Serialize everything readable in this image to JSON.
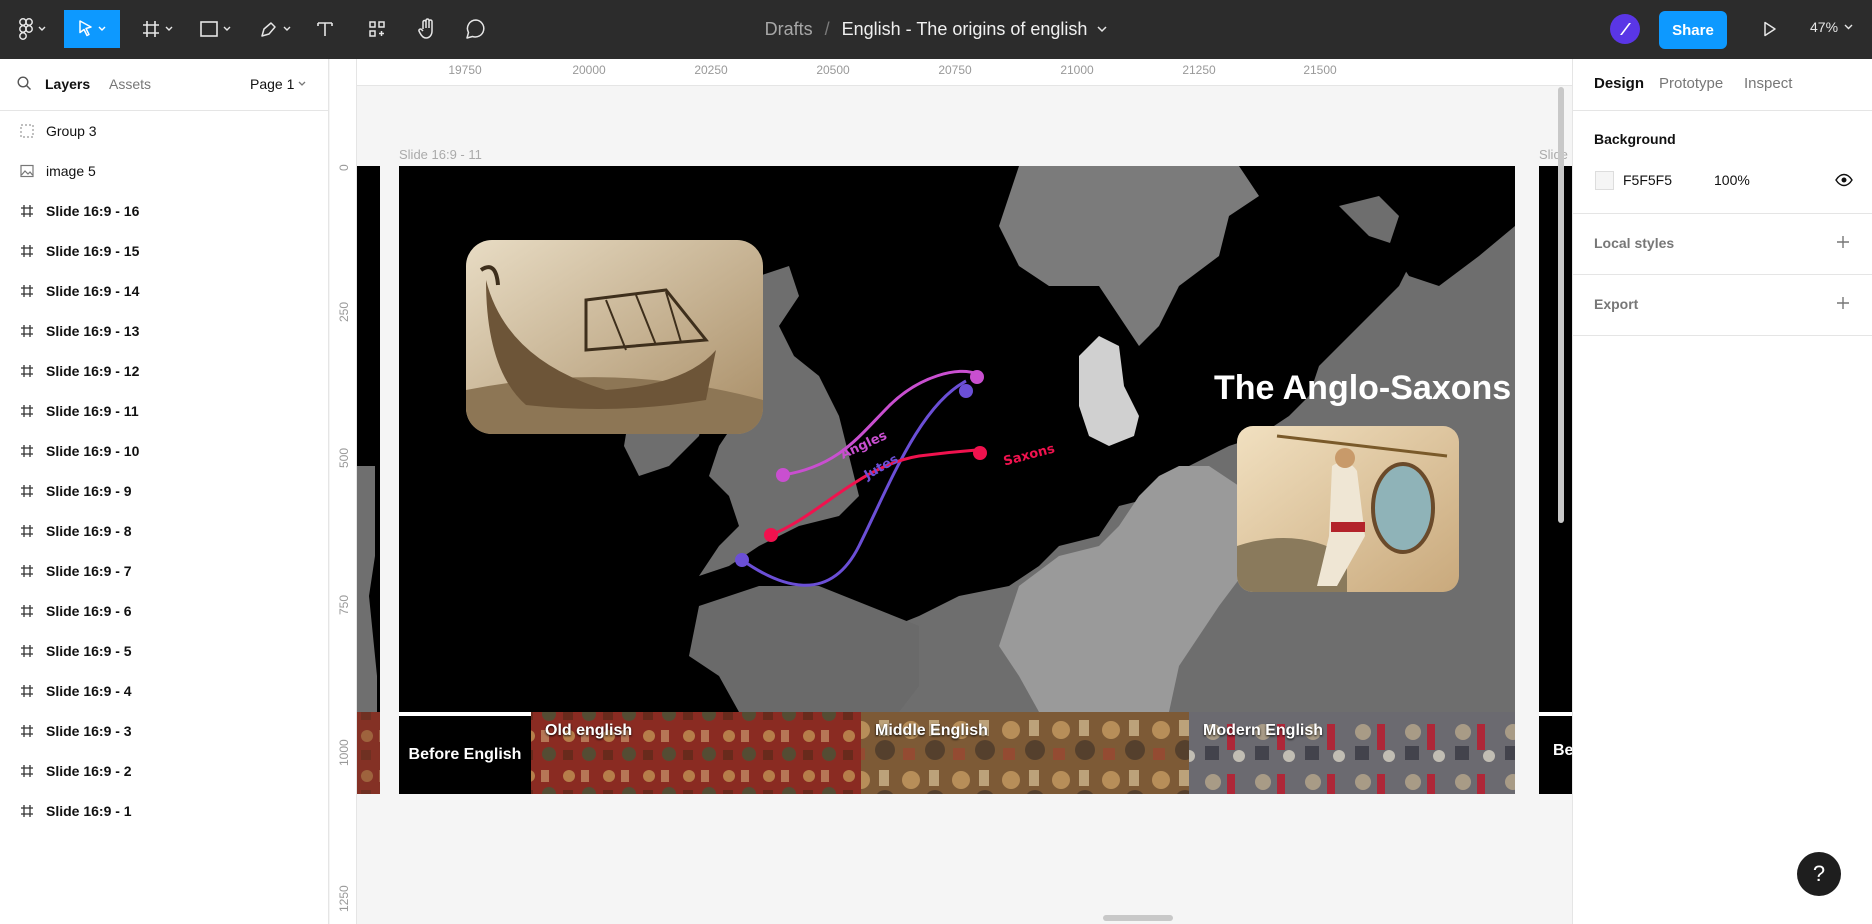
{
  "toolbar": {
    "tools": [
      "main-menu",
      "move",
      "frame",
      "shape",
      "pen",
      "text",
      "resources",
      "hand",
      "comment"
    ]
  },
  "breadcrumb": {
    "drafts": "Drafts",
    "separator": "/",
    "file": "English - The origins of english"
  },
  "header": {
    "share_label": "Share",
    "zoom": "47%"
  },
  "left_panel": {
    "tabs": {
      "layers": "Layers",
      "assets": "Assets"
    },
    "page": "Page 1",
    "layers": [
      {
        "name": "Group 3",
        "kind": "group"
      },
      {
        "name": "image 5",
        "kind": "image"
      },
      {
        "name": "Slide 16:9 - 16",
        "kind": "frame"
      },
      {
        "name": "Slide 16:9 - 15",
        "kind": "frame"
      },
      {
        "name": "Slide 16:9 - 14",
        "kind": "frame"
      },
      {
        "name": "Slide 16:9 - 13",
        "kind": "frame"
      },
      {
        "name": "Slide 16:9 - 12",
        "kind": "frame"
      },
      {
        "name": "Slide 16:9 - 11",
        "kind": "frame"
      },
      {
        "name": "Slide 16:9 - 10",
        "kind": "frame"
      },
      {
        "name": "Slide 16:9 - 9",
        "kind": "frame"
      },
      {
        "name": "Slide 16:9 - 8",
        "kind": "frame"
      },
      {
        "name": "Slide 16:9 - 7",
        "kind": "frame"
      },
      {
        "name": "Slide 16:9 - 6",
        "kind": "frame"
      },
      {
        "name": "Slide 16:9 - 5",
        "kind": "frame"
      },
      {
        "name": "Slide 16:9 - 4",
        "kind": "frame"
      },
      {
        "name": "Slide 16:9 - 3",
        "kind": "frame"
      },
      {
        "name": "Slide 16:9 - 2",
        "kind": "frame"
      },
      {
        "name": "Slide 16:9 - 1",
        "kind": "frame"
      }
    ]
  },
  "right_panel": {
    "tabs": {
      "design": "Design",
      "prototype": "Prototype",
      "inspect": "Inspect"
    },
    "background": {
      "title": "Background",
      "hex": "F5F5F5",
      "opacity": "100%"
    },
    "local_styles": "Local styles",
    "export": "Export"
  },
  "canvas": {
    "ruler_x": [
      "19750",
      "20000",
      "20250",
      "20500",
      "20750",
      "21000",
      "21250",
      "21500"
    ],
    "ruler_y": [
      "0",
      "250",
      "500",
      "750",
      "1000",
      "1250"
    ],
    "frame_label": "Slide 16:9 - 11",
    "frame_label_next": "Slide",
    "slide": {
      "title": "The Anglo-Saxons",
      "routes": {
        "angles": "Angles",
        "jutes": "Jutes",
        "saxons": "Saxons"
      },
      "route_colors": {
        "angles": "#c94fd0",
        "jutes": "#6b4fd6",
        "saxons": "#f0124e"
      },
      "timeline": {
        "before": "Before English",
        "old": "Old english",
        "middle": "Middle English",
        "modern": "Modern English"
      },
      "next_slide_tab": "Be"
    }
  },
  "help": "?"
}
